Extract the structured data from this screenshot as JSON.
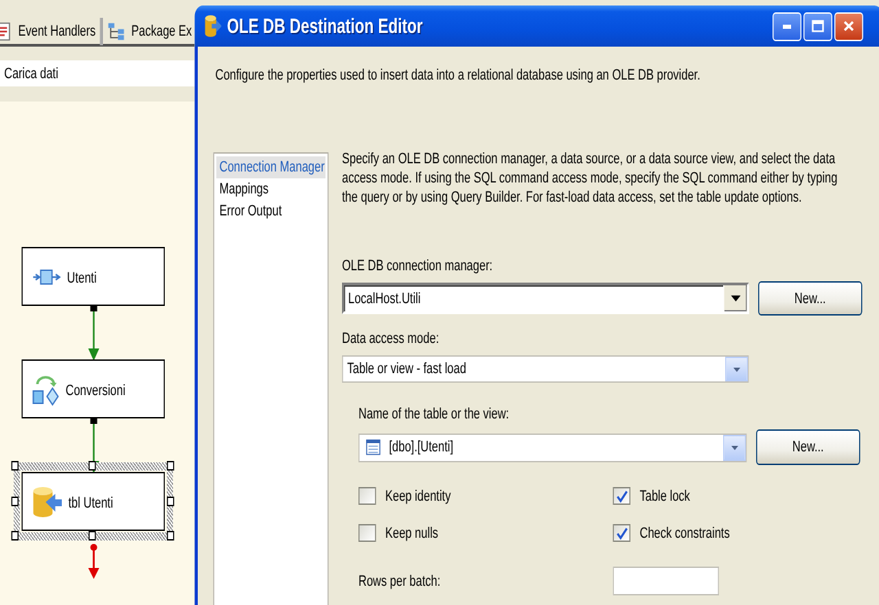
{
  "designer": {
    "tabs": [
      {
        "label": "Event Handlers"
      },
      {
        "label": "Package Ex"
      }
    ],
    "task_selector": {
      "value": "Carica dati"
    },
    "nodes": [
      {
        "label": "Utenti",
        "kind": "source",
        "selected": false
      },
      {
        "label": "Conversioni",
        "kind": "transform",
        "selected": false
      },
      {
        "label": "tbl Utenti",
        "kind": "destination",
        "selected": true
      }
    ]
  },
  "dialog": {
    "title": "OLE DB Destination Editor",
    "description": "Configure the properties used to insert data into a relational database using an OLE DB provider.",
    "nav": [
      {
        "label": "Connection Manager",
        "selected": true
      },
      {
        "label": "Mappings",
        "selected": false
      },
      {
        "label": "Error Output",
        "selected": false
      }
    ],
    "instructions": "Specify an OLE DB connection manager, a data source, or a data source view, and select the data access mode. If using the SQL command access mode, specify the SQL command either by typing the query or by using Query Builder. For fast-load data access, set the table update options.",
    "connection_manager": {
      "label": "OLE DB connection manager:",
      "value": "LocalHost.Utili",
      "button": "New..."
    },
    "access_mode": {
      "label": "Data access mode:",
      "value": "Table or view - fast load"
    },
    "table": {
      "label": "Name of the table or the view:",
      "value": "[dbo].[Utenti]",
      "button": "New..."
    },
    "options": [
      {
        "label": "Keep identity",
        "checked": false
      },
      {
        "label": "Table lock",
        "checked": true
      },
      {
        "label": "Keep nulls",
        "checked": false
      },
      {
        "label": "Check constraints",
        "checked": true
      }
    ],
    "rows_per_batch": {
      "label": "Rows per batch:"
    }
  }
}
